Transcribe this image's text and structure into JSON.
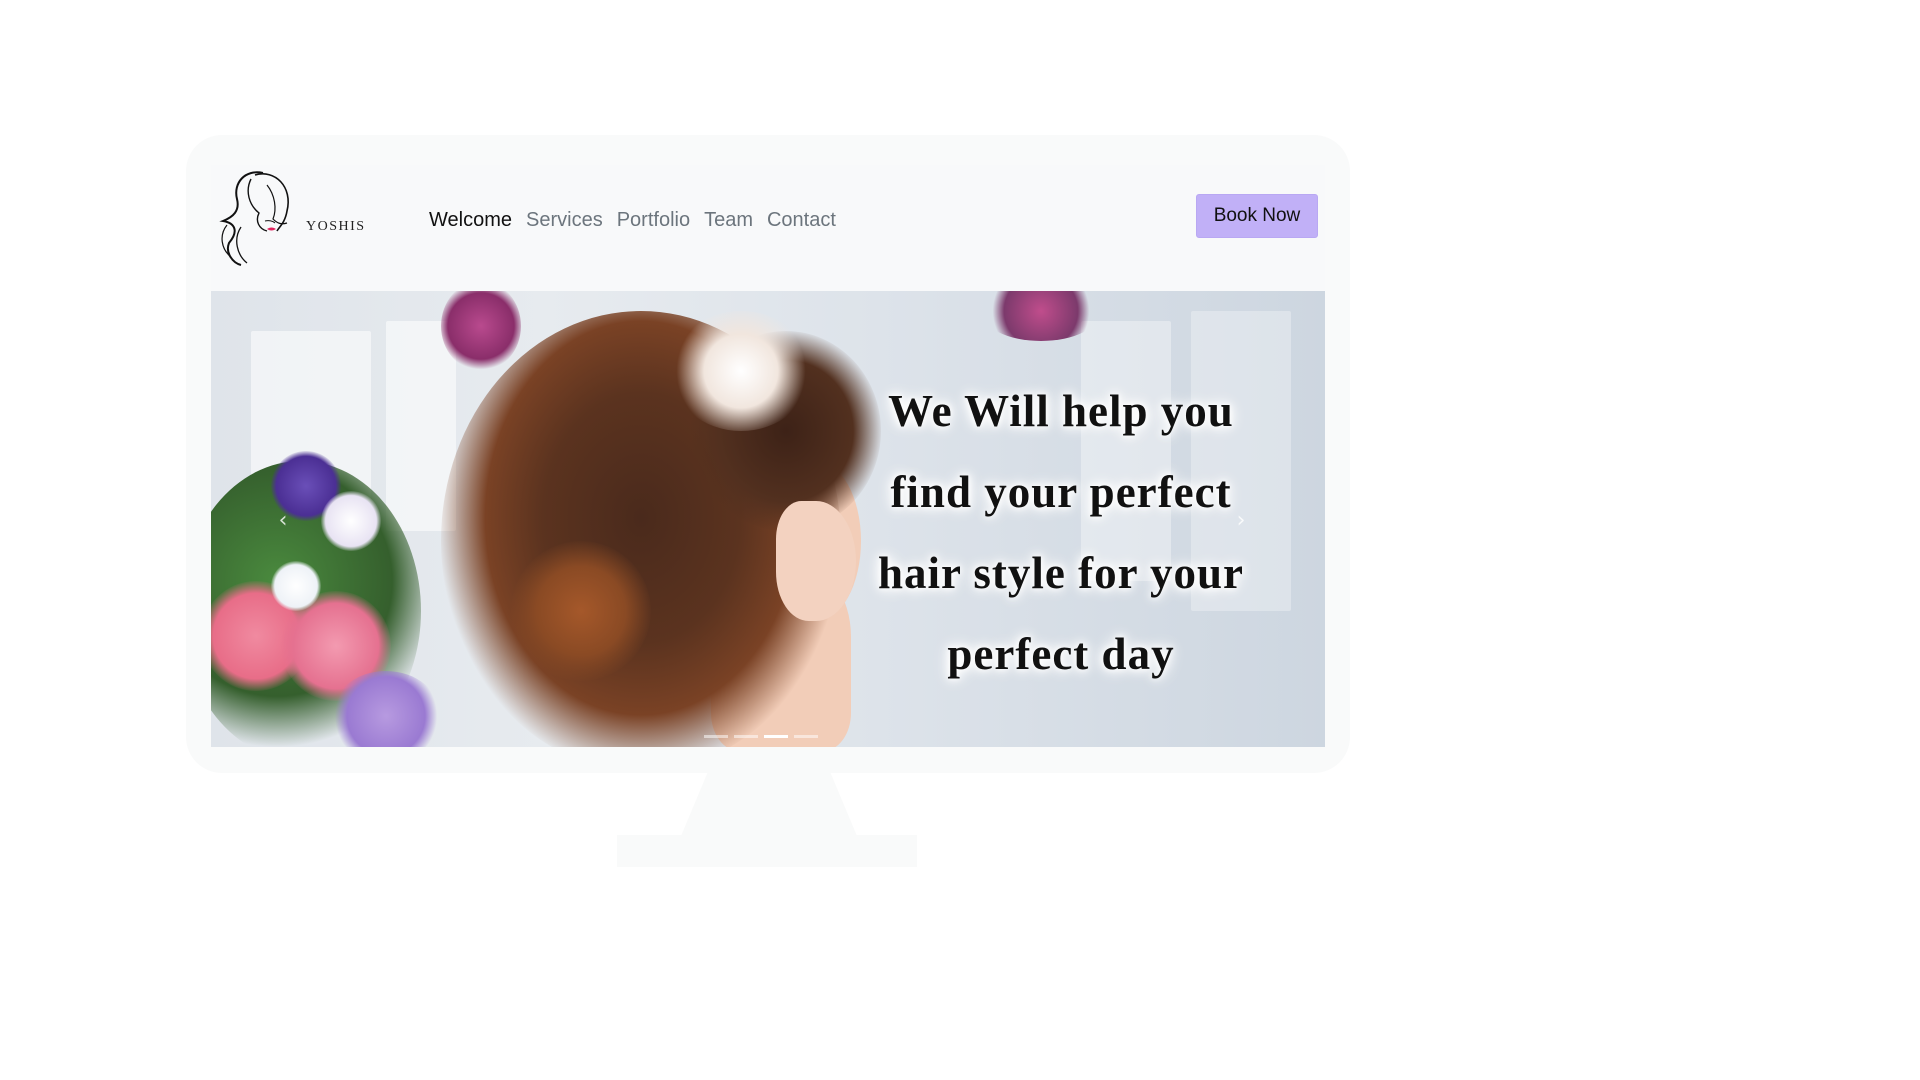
{
  "brand": {
    "name": "YOSHIS"
  },
  "nav": {
    "items": [
      {
        "label": "Welcome",
        "active": true
      },
      {
        "label": "Services",
        "active": false
      },
      {
        "label": "Portfolio",
        "active": false
      },
      {
        "label": "Team",
        "active": false
      },
      {
        "label": "Contact",
        "active": false
      }
    ],
    "cta_label": "Book Now",
    "cta_color": "#c1b0f7"
  },
  "carousel": {
    "slide_text": "We Will help you\nfind your perfect\nhair style  for your\nperfect day",
    "prev_icon": "chevron-left-icon",
    "next_icon": "chevron-right-icon",
    "slide_count": 4,
    "active_slide": 3
  },
  "colors": {
    "page_bg": "#ffffff",
    "frame": "#f9fafa",
    "navbar_bg": "#f8f9fa",
    "nav_active": "#111111",
    "nav_inactive": "#6c757d"
  }
}
